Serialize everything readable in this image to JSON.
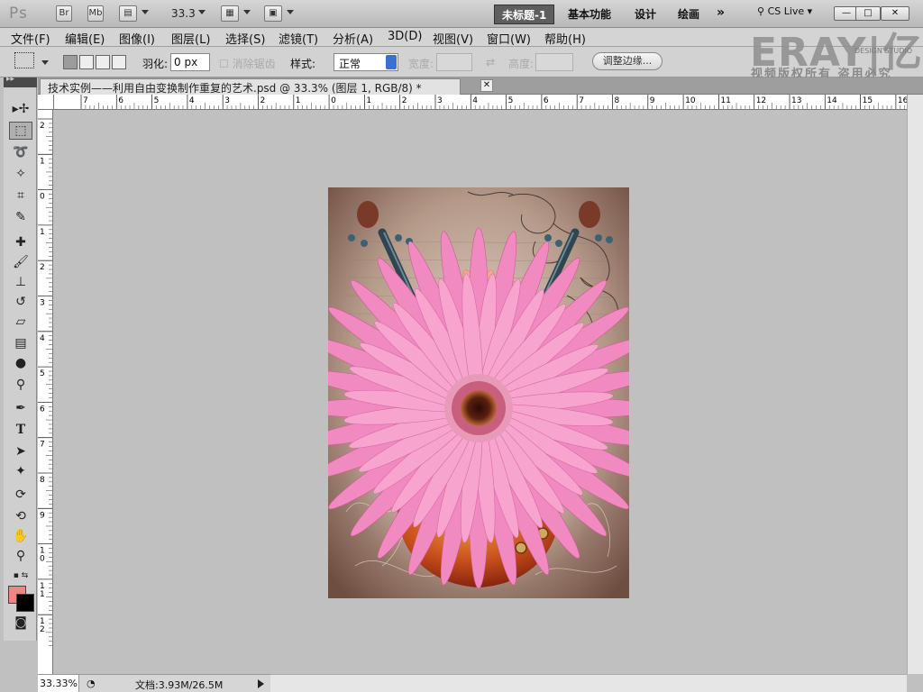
{
  "app": {
    "logo": "Ps",
    "bridge_label": "Br",
    "minibridge_label": "Mb",
    "zoom_value": "33.3",
    "workspaces": [
      "未标题-1",
      "基本功能",
      "设计",
      "绘画"
    ],
    "more_label": "»",
    "cslive_label": "CS Live",
    "window_controls": [
      "—",
      "□",
      "✕"
    ]
  },
  "menu": {
    "items": [
      "文件(F)",
      "编辑(E)",
      "图像(I)",
      "图层(L)",
      "选择(S)",
      "滤镜(T)",
      "分析(A)",
      "3D(D)",
      "视图(V)",
      "窗口(W)",
      "帮助(H)"
    ]
  },
  "watermark": {
    "brand": "ERAY|亿瑞",
    "sub": "DESIGN STUDIO",
    "line": "视频版权所有  盗用必究"
  },
  "options": {
    "feather_label": "羽化:",
    "feather_value": "0 px",
    "antialias_label": "消除锯齿",
    "style_label": "样式:",
    "style_value": "正常",
    "width_label": "宽度:",
    "height_label": "高度:",
    "refine_label": "调整边缘..."
  },
  "document": {
    "tab_title": "技术实例——利用自由变换制作重复的艺术.psd @ 33.3% (图层 1, RGB/8) *",
    "close_label": "✕"
  },
  "rulers": {
    "top": [
      "7",
      "6",
      "5",
      "4",
      "3",
      "2",
      "1",
      "0",
      "1",
      "2",
      "3",
      "4",
      "5",
      "6",
      "7",
      "8",
      "9",
      "10",
      "11",
      "12",
      "13",
      "14",
      "15",
      "16"
    ],
    "left": [
      "2",
      "1",
      "0",
      "1",
      "2",
      "3",
      "4",
      "5",
      "6",
      "7",
      "8",
      "9",
      "1\n0",
      "1\n1",
      "1\n2"
    ]
  },
  "status": {
    "zoom": "33.33%",
    "doc_info": "文档:3.93M/26.5M"
  },
  "colors": {
    "foreground": "#ef8585",
    "background": "#000000",
    "active_workspace": "#5e5e5e"
  }
}
